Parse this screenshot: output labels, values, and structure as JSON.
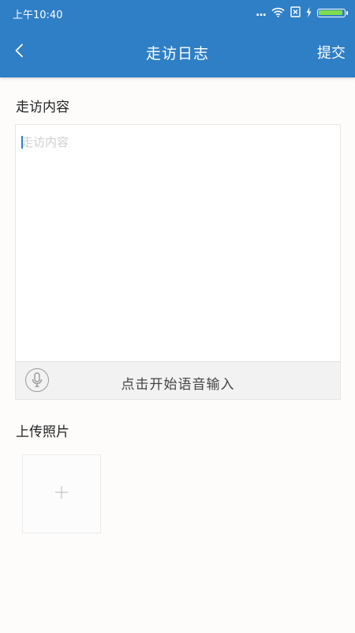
{
  "status_bar": {
    "time": "上午10:40",
    "dots": "...",
    "icons": [
      "signal-dots-icon",
      "wifi-icon",
      "sim-card-icon",
      "charging-icon",
      "battery-icon"
    ],
    "battery_color": "#7fdc4f"
  },
  "nav_bar": {
    "title": "走访日志",
    "submit_label": "提交",
    "back_icon": "chevron-left-icon",
    "background_color": "#2f7fc6"
  },
  "visit_content": {
    "label": "走访内容",
    "placeholder": "走访内容",
    "value": ""
  },
  "voice_input": {
    "label": "点击开始语音输入",
    "icon": "microphone-icon"
  },
  "photo_upload": {
    "label": "上传照片",
    "add_icon": "plus-icon"
  }
}
